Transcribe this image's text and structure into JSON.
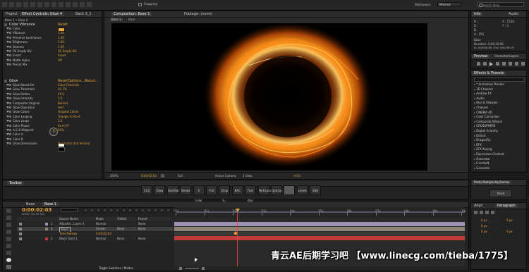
{
  "menubar": {
    "tools_label": "Snapping",
    "workspace_label": "Workspace:",
    "workspace_value": "Minimal",
    "search_placeholder": "Search Help"
  },
  "effect_controls": {
    "tab_project": "Project",
    "tab_effects": "Effect Controls: Glow 4",
    "tab_other": "Back 3_1",
    "breadcrumb": "Base 1 • Glow 4",
    "section1_name": "Color Vibrance",
    "section1_reset": "Reset",
    "rows1": [
      {
        "label": "Color",
        "value": ""
      },
      {
        "label": "Vibrance",
        "value": "1.00"
      },
      {
        "label": "Preserve Luminance",
        "value": "1.00"
      },
      {
        "label": "Brightness",
        "value": "1.00"
      },
      {
        "label": "Gamma",
        "value": "1.00"
      },
      {
        "label": "Fill Empty BG",
        "value": "Fill Empty BG"
      },
      {
        "label": "Invert",
        "value": "Invert"
      },
      {
        "label": "Matte Alpha",
        "value": "Off"
      },
      {
        "label": "Preset Mix",
        "value": ""
      }
    ],
    "section2_name": "Glow",
    "section2_reset": "Reset",
    "section2_opts": "Options...",
    "section2_about": "About...",
    "rows2": [
      {
        "label": "Glow Based On",
        "value": "Color Channels"
      },
      {
        "label": "Glow Threshold",
        "value": "44.7%"
      },
      {
        "label": "Glow Radius",
        "value": "49.0"
      },
      {
        "label": "Glow Intensity",
        "value": "2.0"
      },
      {
        "label": "Composite Original",
        "value": "Behind"
      },
      {
        "label": "Glow Operation",
        "value": "Add"
      },
      {
        "label": "Glow Colors",
        "value": "Original Colors"
      },
      {
        "label": "Color Looping",
        "value": "Triangle A>B>A"
      },
      {
        "label": "Color Loops",
        "value": "1.0"
      },
      {
        "label": "Color Phase",
        "value": "0x+0.0°"
      },
      {
        "label": "A & B Midpoint",
        "value": "50%"
      },
      {
        "label": "Color A",
        "value": ""
      },
      {
        "label": "Color B",
        "value": ""
      },
      {
        "label": "Glow Dimensions",
        "value": "Horizontal and Vertical"
      }
    ]
  },
  "composition": {
    "tab_comp": "Composition: Base 1",
    "tab_footage": "Footage: (none)",
    "subtab1": "Base 1",
    "subtab2": "Base",
    "zoom": "200%",
    "timecode": "0;00;02;03",
    "resolution": "Full",
    "camera": "Active Camera",
    "views": "1 View",
    "exposure": "+0.0"
  },
  "info_panel": {
    "tab_info": "Info",
    "tab_audio": "Audio",
    "r": "R :",
    "g": "G :",
    "b": "B :",
    "a": "A : 255",
    "x": "X : 1528",
    "y": "Y : 3",
    "layer": "Base",
    "duration": "Duration: 0;00;10;00",
    "in_out": "In: 0;00;00;00, Out: 0;00;09;29"
  },
  "preview_panel": {
    "tab_preview": "Preview",
    "tab_char": "Character/Layers"
  },
  "effects_presets": {
    "tab": "Effects & Presets",
    "search": "",
    "items": [
      "* Animation Presets",
      "3D Channel",
      "Andrew FX",
      "Audio",
      "Blur & Sharpen",
      "Channel",
      "CINEMA 4D",
      "Color Correction",
      "Composite Wizard",
      "CROSSPHERE",
      "Digital Anarchy",
      "Distort",
      "DragonFly",
      "EFX",
      "EFX Keying",
      "Expression Controls",
      "Generate",
      "Frischluft",
      "Generate"
    ]
  },
  "paste_panel": {
    "tab": "Paste Multiple Keyframes",
    "button": "Paste"
  },
  "paragraph_panel": {
    "tab_align": "Align",
    "tab_para": "Paragraph",
    "px_values": [
      "0 px",
      "0 px",
      "0 px",
      "0 px",
      "0 px"
    ]
  },
  "toolbar_panel": {
    "tab": "Toolbar",
    "buttons": [
      "CG3",
      "Glow",
      "Hue/Sat",
      "Stroke",
      "4 Color",
      "Tint",
      "Drop S...",
      "BAC",
      "Fast Blur",
      "Particular",
      "Optical...",
      "",
      "Levels",
      "Edit"
    ]
  },
  "timeline": {
    "tab1": "Base",
    "tab2": "Base 1",
    "timecode": "0:00:02:03",
    "frames": "00063 (30.00 fps)",
    "col_name": "Source Name",
    "col_mode": "Mode",
    "col_trkmat": "TrkMat",
    "col_parent": "Parent",
    "layers": [
      {
        "num": "1",
        "name": "Adjustm...Layer 4",
        "mode": "Normal",
        "trk": "",
        "parent": "None"
      },
      {
        "num": "2",
        "name": "Base",
        "mode": "Screen",
        "trk": "None",
        "parent": "None"
      },
      {
        "num": "",
        "name": "Time Remap",
        "mode": "0;00;02;03",
        "trk": "",
        "parent": ""
      },
      {
        "num": "3",
        "name": "Black Solid 1",
        "mode": "Normal",
        "trk": "None",
        "parent": "None"
      }
    ],
    "ruler_labels": [
      "0s",
      "01s",
      "02s",
      "03s",
      "04s",
      "05s",
      "06s",
      "07s",
      "08s",
      "09s",
      "10s"
    ],
    "footer": "Toggle Switches / Modes"
  },
  "watermark": {
    "text": "青云AE后期学习吧 【www.linecg.com/tieba/1775】"
  },
  "colors": {
    "accent_orange": "#e2a33c",
    "layer_label_red": "#c23b3b",
    "bar_tan": "#8f8472",
    "bar_blue": "#6f7fa3",
    "bar_lavender": "#9c93b4"
  }
}
